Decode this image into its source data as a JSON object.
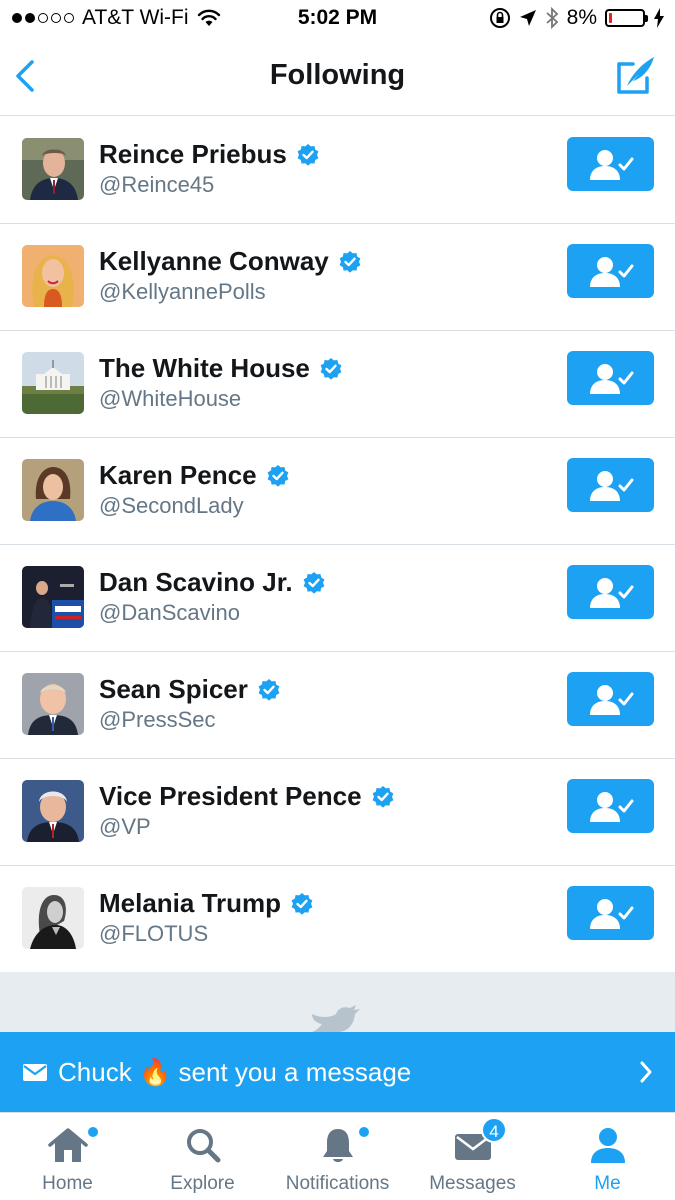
{
  "status_bar": {
    "carrier": "AT&T Wi-Fi",
    "time": "5:02 PM",
    "battery_percent": "8%",
    "battery_level": 0.08,
    "signal_bars_filled": 2,
    "signal_bars_total": 5
  },
  "nav": {
    "title": "Following",
    "back_icon": "chevron-left-icon",
    "compose_icon": "compose-tweet-icon"
  },
  "following": [
    {
      "name": "Reince Priebus",
      "handle": "@Reince45",
      "verified": true
    },
    {
      "name": "Kellyanne Conway",
      "handle": "@KellyannePolls",
      "verified": true
    },
    {
      "name": "The White House",
      "handle": "@WhiteHouse",
      "verified": true
    },
    {
      "name": "Karen Pence",
      "handle": "@SecondLady",
      "verified": true
    },
    {
      "name": "Dan Scavino Jr.",
      "handle": "@DanScavino",
      "verified": true
    },
    {
      "name": "Sean Spicer",
      "handle": "@PressSec",
      "verified": true
    },
    {
      "name": "Vice President Pence",
      "handle": "@VP",
      "verified": true
    },
    {
      "name": "Melania Trump",
      "handle": "@FLOTUS",
      "verified": true
    }
  ],
  "banner": {
    "sender": "Chuck",
    "emoji": "🔥",
    "text": "sent you a message"
  },
  "tabs": [
    {
      "label": "Home",
      "icon": "home-icon",
      "dot": true
    },
    {
      "label": "Explore",
      "icon": "search-icon",
      "dot": false
    },
    {
      "label": "Notifications",
      "icon": "bell-icon",
      "dot": true
    },
    {
      "label": "Messages",
      "icon": "envelope-icon",
      "badge": "4"
    },
    {
      "label": "Me",
      "icon": "person-icon",
      "active": true
    }
  ],
  "colors": {
    "accent": "#1da1f2",
    "text_primary": "#14171a",
    "text_secondary": "#657786",
    "divider": "#d8dfe5",
    "battery_low": "#e8221b"
  }
}
